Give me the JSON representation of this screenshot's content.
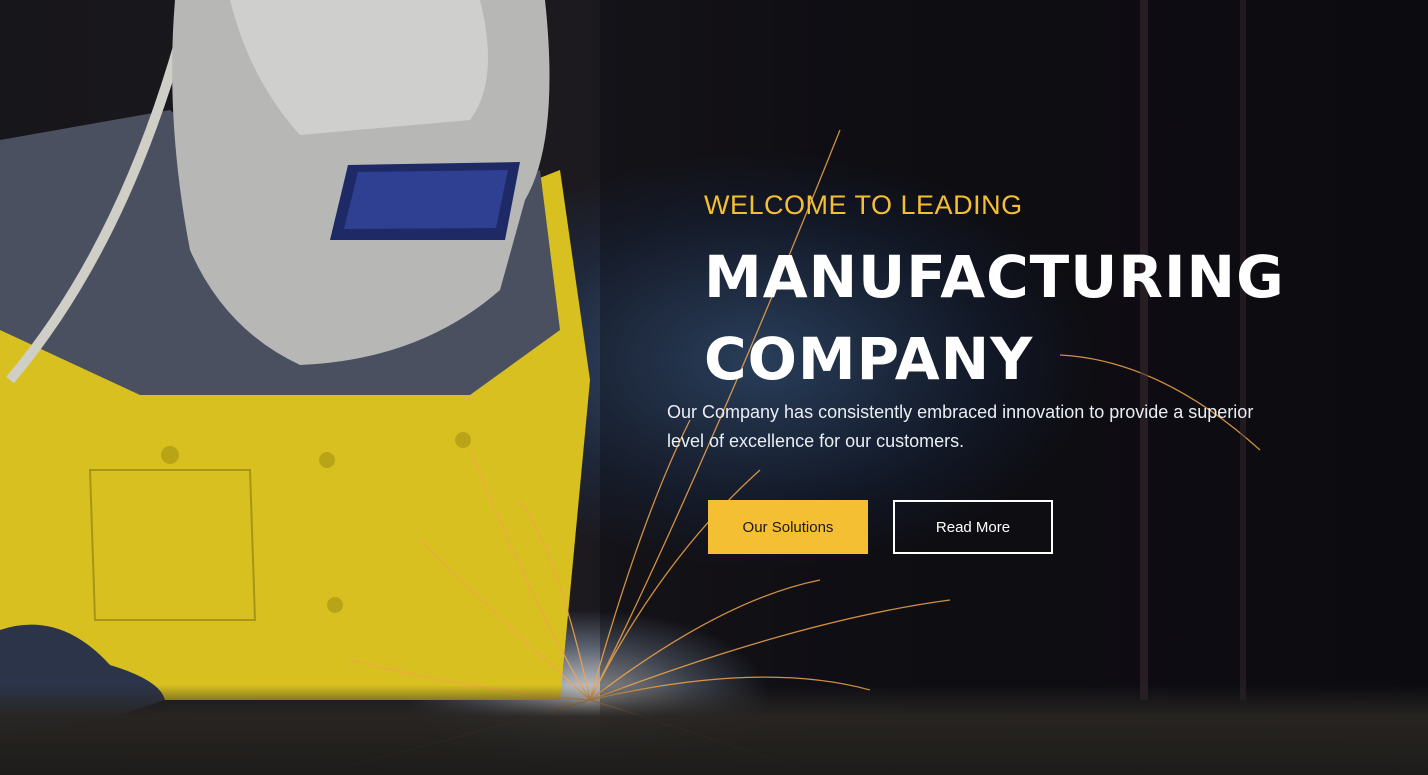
{
  "hero": {
    "eyebrow": "WELCOME TO LEADING",
    "headline_line1": "MANUFACTURING",
    "headline_line2": "COMPANY",
    "description": "Our Company has consistently embraced innovation to provide a superior level of excellence for our customers.",
    "primary_button": "Our Solutions",
    "secondary_button": "Read More"
  },
  "colors": {
    "accent": "#f4bf33",
    "text": "#ffffff"
  }
}
